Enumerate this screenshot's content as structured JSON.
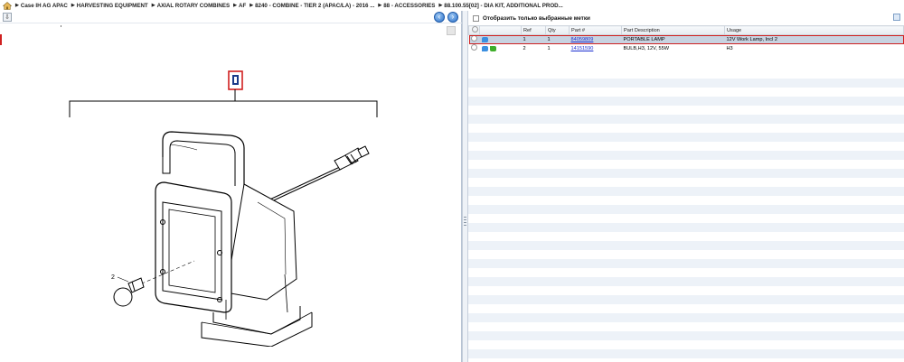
{
  "breadcrumb": {
    "items": [
      "Case IH AG APAC",
      "HARVESTING EQUIPMENT",
      "AXIAL ROTARY COMBINES",
      "AF",
      "8240 - COMBINE - TIER 2 (APAC/LA) - 2016 ...",
      "88 - ACCESSORIES",
      "88.100.55[02] - DIA KIT, ADDITIONAL PROD..."
    ]
  },
  "drawing": {
    "callout": "2",
    "icon_color": "#1a3a8a",
    "highlight_color": "#d02020"
  },
  "filter": {
    "label": "Отобразить только выбранные метки",
    "checked": false
  },
  "table": {
    "headers": [
      "",
      "",
      "Ref",
      "Qty",
      "Part #",
      "Part Description",
      "Usage"
    ],
    "rows": [
      {
        "ref": "1",
        "qty": "1",
        "part": "84059809",
        "desc": "PORTABLE LAMP",
        "usage": "12V Work Lamp, Incl 2",
        "selected": true
      },
      {
        "ref": "2",
        "qty": "1",
        "part": "14151590",
        "desc": "BULB,H3, 12V, 55W",
        "usage": "H3",
        "selected": false
      }
    ]
  },
  "colors": {
    "selected_row": "#c8d3e1",
    "link": "#1a2fd0",
    "stripe": "#edf2f8"
  }
}
